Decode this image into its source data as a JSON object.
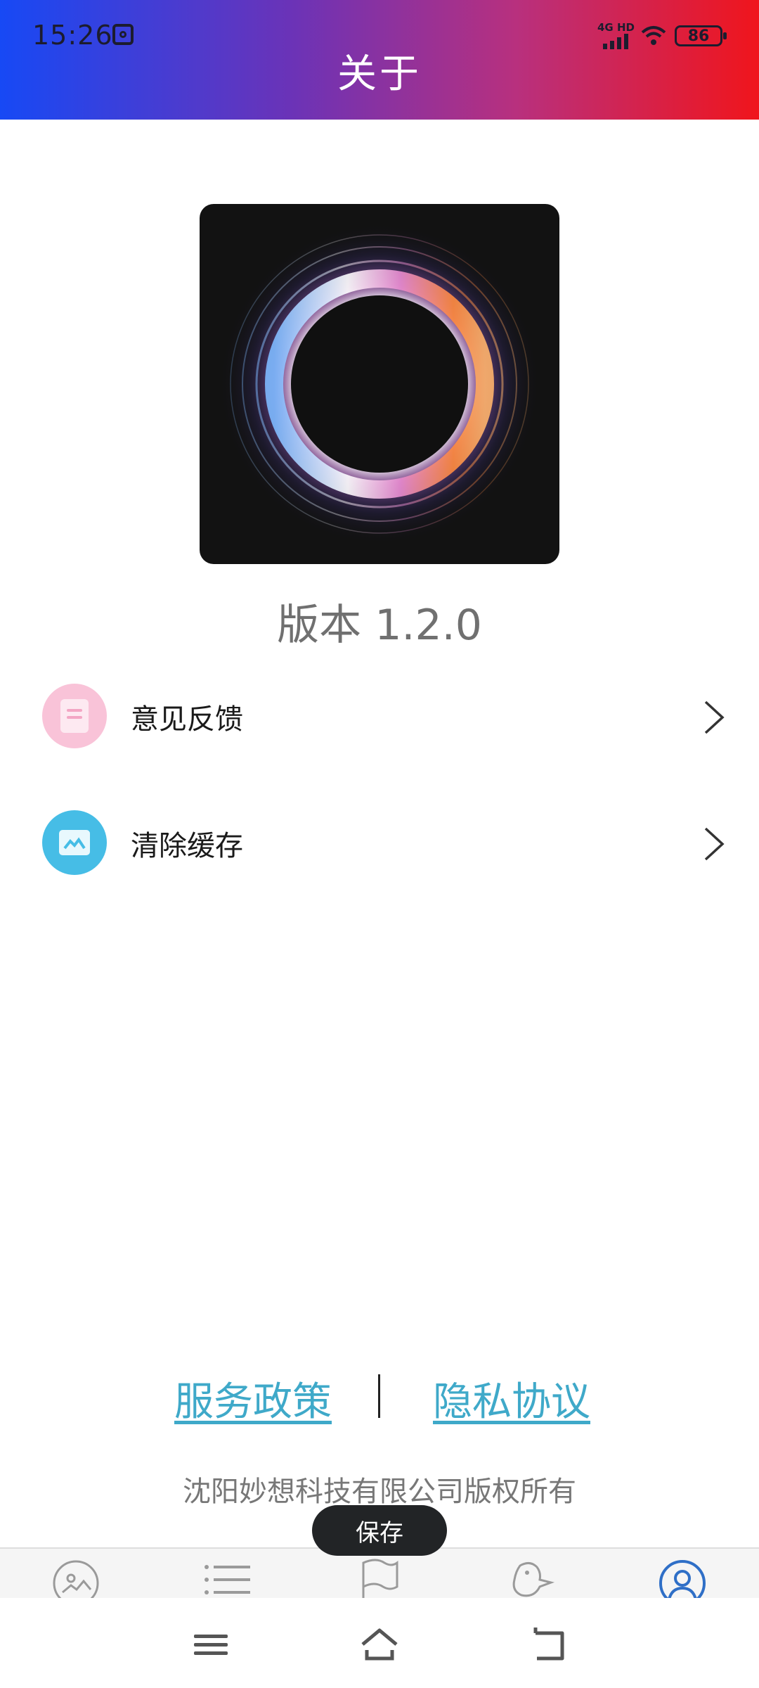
{
  "status_bar": {
    "time": "15:26",
    "network_label": "4G HD",
    "battery": "86"
  },
  "header": {
    "title": "关于",
    "gradient_colors": [
      "#1749f5",
      "#6a33b8",
      "#b8307e",
      "#f0151c"
    ]
  },
  "app": {
    "version_text": "版本 1.2.0"
  },
  "menu": {
    "items": [
      {
        "label": "意见反馈",
        "icon": "feedback-document-icon",
        "color": "#f9c3d8"
      },
      {
        "label": "清除缓存",
        "icon": "clear-cache-image-icon",
        "color": "#46bde6"
      }
    ]
  },
  "footer": {
    "service_policy": "服务政策",
    "privacy_agreement": "隐私协议",
    "copyright": "沈阳妙想科技有限公司版权所有",
    "link_color": "#3fa9c9"
  },
  "toast": {
    "text": "保存"
  },
  "tabbar": {
    "tabs": [
      {
        "icon": "gallery-icon"
      },
      {
        "icon": "list-icon"
      },
      {
        "icon": "flag-icon"
      },
      {
        "icon": "bird-icon"
      },
      {
        "icon": "profile-icon",
        "active": true
      }
    ],
    "active_color": "#2f6fc7"
  },
  "system_nav": {
    "buttons": [
      "menu-icon",
      "home-icon",
      "back-icon"
    ]
  }
}
